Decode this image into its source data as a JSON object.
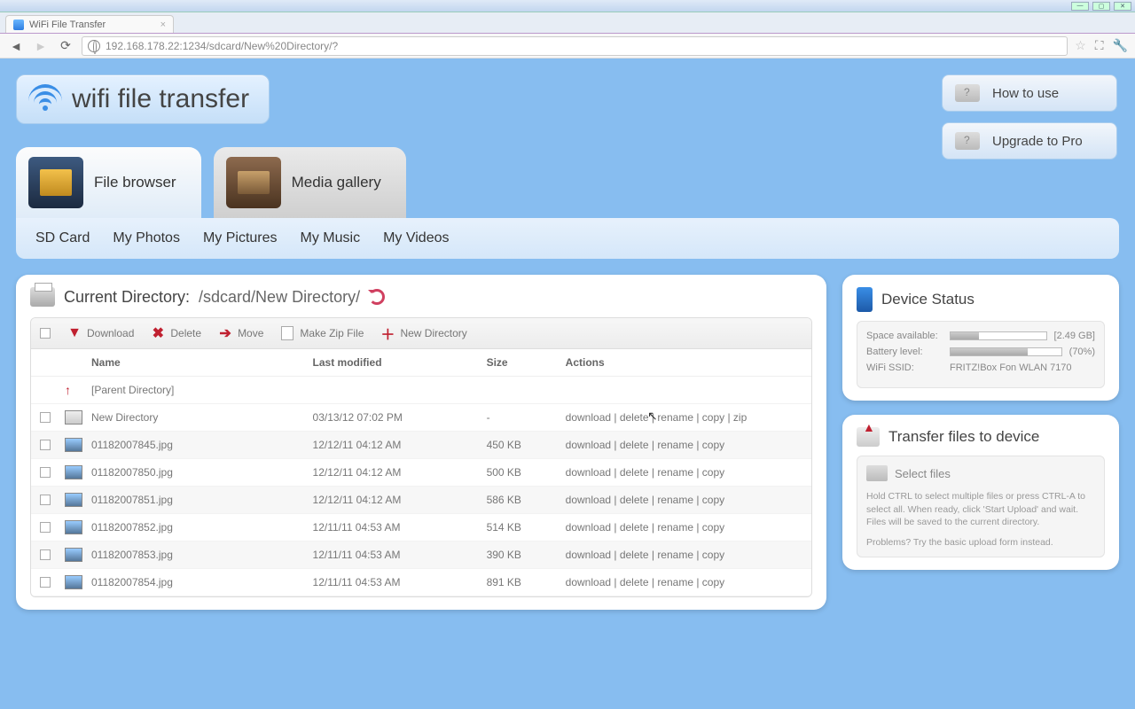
{
  "browser": {
    "tab_title": "WiFi File Transfer",
    "url": "192.168.178.22:1234/sdcard/New%20Directory/?"
  },
  "logo": "wifi file transfer",
  "corner_buttons": {
    "howto": "How to use",
    "upgrade": "Upgrade to Pro"
  },
  "main_tabs": {
    "file_browser": "File browser",
    "media_gallery": "Media gallery"
  },
  "subnav": [
    "SD Card",
    "My Photos",
    "My Pictures",
    "My Music",
    "My Videos"
  ],
  "current_dir_label": "Current Directory:",
  "current_dir_path": "/sdcard/New Directory/",
  "toolbar": {
    "download": "Download",
    "delete": "Delete",
    "move": "Move",
    "zip": "Make Zip File",
    "newdir": "New Directory"
  },
  "columns": {
    "name": "Name",
    "modified": "Last modified",
    "size": "Size",
    "actions": "Actions"
  },
  "parent_row": "[Parent Directory]",
  "rows": [
    {
      "name": "New Directory",
      "mod": "03/13/12 07:02 PM",
      "size": "-",
      "actions": "download | delete | rename | copy | zip",
      "folder": true
    },
    {
      "name": "01182007845.jpg",
      "mod": "12/12/11 04:12 AM",
      "size": "450 KB",
      "actions": "download | delete | rename | copy"
    },
    {
      "name": "01182007850.jpg",
      "mod": "12/12/11 04:12 AM",
      "size": "500 KB",
      "actions": "download | delete | rename | copy"
    },
    {
      "name": "01182007851.jpg",
      "mod": "12/12/11 04:12 AM",
      "size": "586 KB",
      "actions": "download | delete | rename | copy"
    },
    {
      "name": "01182007852.jpg",
      "mod": "12/11/11 04:53 AM",
      "size": "514 KB",
      "actions": "download | delete | rename | copy"
    },
    {
      "name": "01182007853.jpg",
      "mod": "12/11/11 04:53 AM",
      "size": "390 KB",
      "actions": "download | delete | rename | copy"
    },
    {
      "name": "01182007854.jpg",
      "mod": "12/11/11 04:53 AM",
      "size": "891 KB",
      "actions": "download | delete | rename | copy"
    }
  ],
  "device_status": {
    "title": "Device Status",
    "space_label": "Space available:",
    "space_val": "[2.49 GB]",
    "space_pct": 30,
    "battery_label": "Battery level:",
    "battery_val": "(70%)",
    "battery_pct": 70,
    "ssid_label": "WiFi SSID:",
    "ssid_val": "FRITZ!Box Fon WLAN 7170"
  },
  "transfer": {
    "title": "Transfer files to device",
    "select": "Select files",
    "help": "Hold CTRL to select multiple files or press CTRL-A to select all. When ready, click 'Start Upload' and wait. Files will be saved to the current directory.",
    "problems": "Problems? Try the basic upload form instead."
  }
}
